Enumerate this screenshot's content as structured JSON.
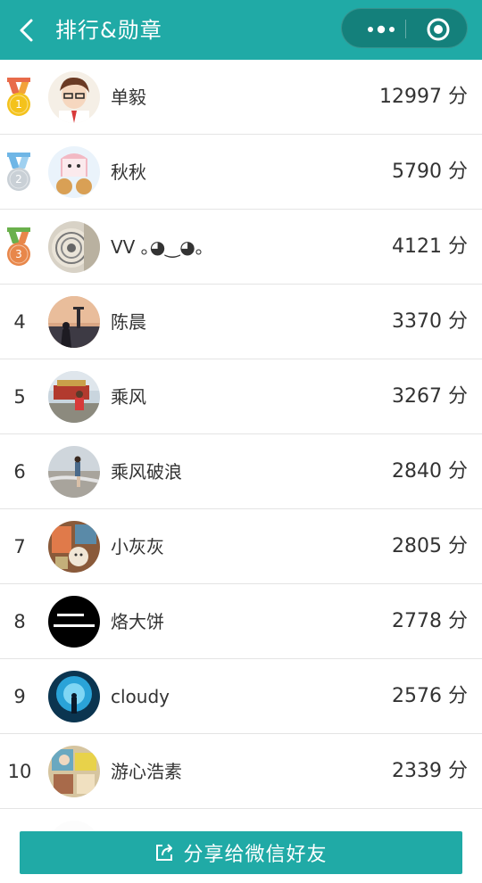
{
  "header": {
    "title": "排行&勋章",
    "back_icon": "chevron-left-icon",
    "more_icon": "more-dots-icon",
    "close_icon": "mini-program-close-icon"
  },
  "colors": {
    "primary": "#20aaa6",
    "capsule": "#14807b",
    "gold": "#f4c21c",
    "silver": "#c9d0d6",
    "bronze": "#e8874a"
  },
  "leaderboard": [
    {
      "rank": "1",
      "medal": "gold",
      "name": "单毅",
      "score": "12997 分"
    },
    {
      "rank": "2",
      "medal": "silver",
      "name": "秋秋",
      "score": "5790 分"
    },
    {
      "rank": "3",
      "medal": "bronze",
      "name": "VV ｡◕‿◕｡",
      "score": "4121 分"
    },
    {
      "rank": "4",
      "medal": "",
      "name": "陈晨",
      "score": "3370 分"
    },
    {
      "rank": "5",
      "medal": "",
      "name": "乘风",
      "score": "3267 分"
    },
    {
      "rank": "6",
      "medal": "",
      "name": "乘风破浪",
      "score": "2840 分"
    },
    {
      "rank": "7",
      "medal": "",
      "name": "小灰灰",
      "score": "2805 分"
    },
    {
      "rank": "8",
      "medal": "",
      "name": "烙大饼",
      "score": "2778 分"
    },
    {
      "rank": "9",
      "medal": "",
      "name": "cloudy",
      "score": "2576 分"
    },
    {
      "rank": "10",
      "medal": "",
      "name": "游心浩素",
      "score": "2339 分"
    }
  ],
  "footer": {
    "share_label": "分享给微信好友",
    "share_icon": "share-icon"
  }
}
